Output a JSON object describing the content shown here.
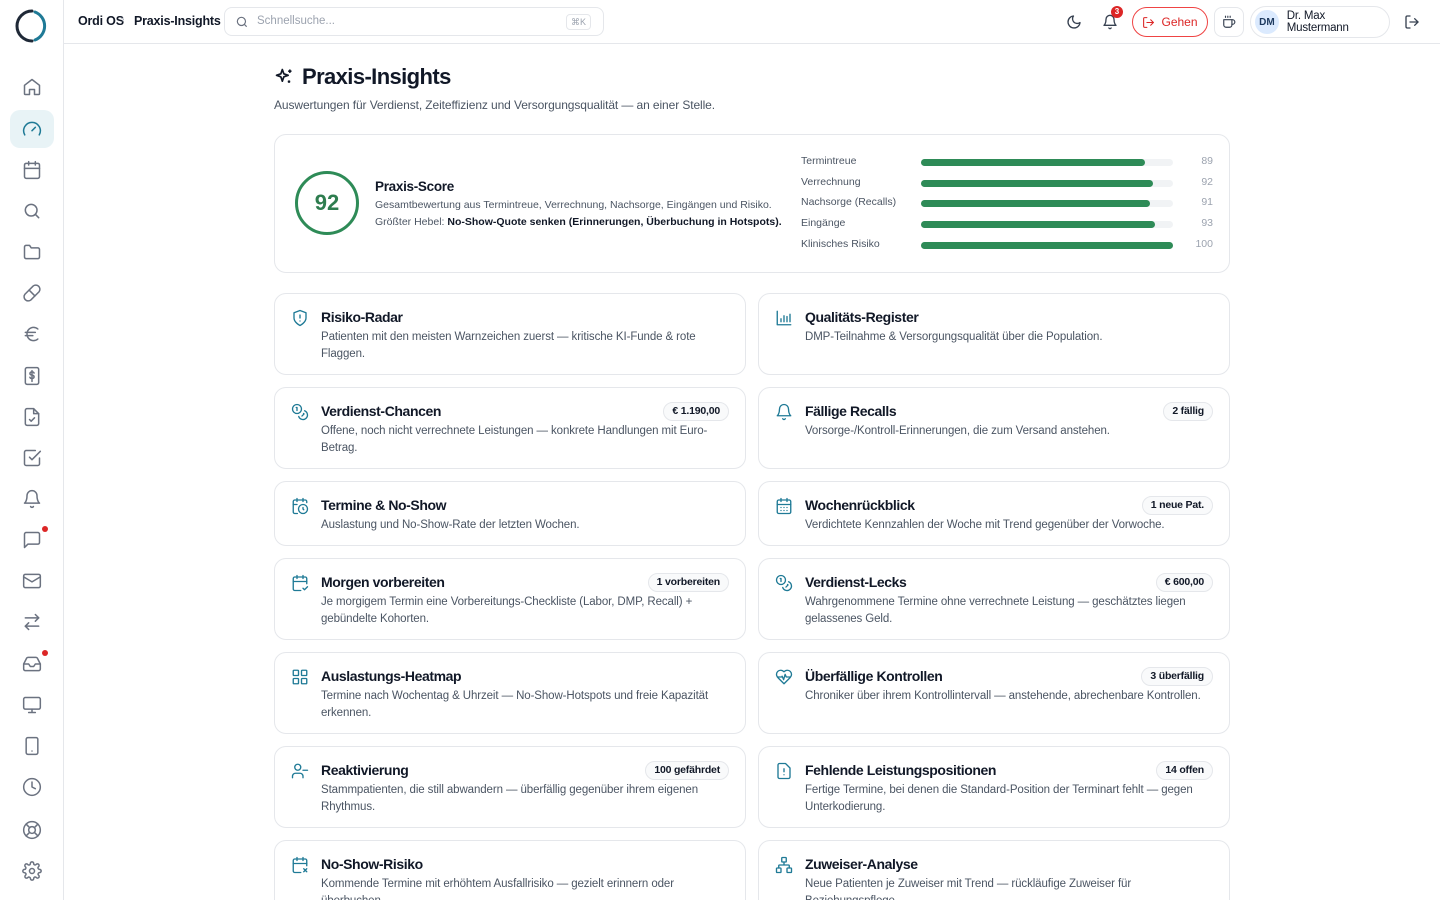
{
  "app": {
    "name": "Ordi OS",
    "page": "Praxis-Insights"
  },
  "search": {
    "placeholder": "Schnellsuche...",
    "shortcut": "⌘K"
  },
  "header": {
    "notification_count": "3",
    "go_label": "Gehen",
    "user_initials": "DM",
    "user_name": "Dr. Max Mustermann"
  },
  "page": {
    "title": "Praxis-Insights",
    "subtitle": "Auswertungen für Verdienst, Zeiteffizienz und Versorgungsqualität — an einer Stelle."
  },
  "score": {
    "value": "92",
    "title": "Praxis-Score",
    "description": "Gesamtbewertung aus Termintreue, Verrechnung, Nachsorge, Eingängen und Risiko.",
    "lever_label": "Größter Hebel:",
    "lever_text": "No-Show-Quote senken (Erinnerungen, Überbuchung in Hotspots).",
    "metrics": [
      {
        "label": "Termintreue",
        "value": 89
      },
      {
        "label": "Verrechnung",
        "value": 92
      },
      {
        "label": "Nachsorge (Recalls)",
        "value": 91
      },
      {
        "label": "Eingänge",
        "value": 93
      },
      {
        "label": "Klinisches Risiko",
        "value": 100
      }
    ]
  },
  "cards": [
    {
      "title": "Risiko-Radar",
      "description": "Patienten mit den meisten Warnzeichen zuerst — kritische KI-Funde & rote Flaggen.",
      "badge": "",
      "icon": "shield-alert-icon"
    },
    {
      "title": "Qualitäts-Register",
      "description": "DMP-Teilnahme & Versorgungsqualität über die Population.",
      "badge": "",
      "icon": "bar-chart-icon"
    },
    {
      "title": "Verdienst-Chancen",
      "description": "Offene, noch nicht verrechnete Leistungen — konkrete Handlungen mit Euro-Betrag.",
      "badge": "€ 1.190,00",
      "icon": "coins-icon"
    },
    {
      "title": "Fällige Recalls",
      "description": "Vorsorge-/Kontroll-Erinnerungen, die zum Versand anstehen.",
      "badge": "2 fällig",
      "icon": "bell-icon"
    },
    {
      "title": "Termine & No-Show",
      "description": "Auslastung und No-Show-Rate der letzten Wochen.",
      "badge": "",
      "icon": "calendar-clock-icon"
    },
    {
      "title": "Wochenrückblick",
      "description": "Verdichtete Kennzahlen der Woche mit Trend gegenüber der Vorwoche.",
      "badge": "1 neue Pat.",
      "icon": "calendar-days-icon"
    },
    {
      "title": "Morgen vorbereiten",
      "description": "Je morgigem Termin eine Vorbereitungs-Checkliste (Labor, DMP, Recall) + gebündelte Kohorten.",
      "badge": "1 vorbereiten",
      "icon": "calendar-check-icon"
    },
    {
      "title": "Verdienst-Lecks",
      "description": "Wahrgenommene Termine ohne verrechnete Leistung — geschätztes liegen gelassenes Geld.",
      "badge": "€ 600,00",
      "icon": "coins-icon"
    },
    {
      "title": "Auslastungs-Heatmap",
      "description": "Termine nach Wochentag & Uhrzeit — No-Show-Hotspots und freie Kapazität erkennen.",
      "badge": "",
      "icon": "grid-icon"
    },
    {
      "title": "Überfällige Kontrollen",
      "description": "Chroniker über ihrem Kontrollintervall — anstehende, abrechenbare Kontrollen.",
      "badge": "3 überfällig",
      "icon": "heart-pulse-icon"
    },
    {
      "title": "Reaktivierung",
      "description": "Stammpatienten, die still abwandern — überfällig gegenüber ihrem eigenen Rhythmus.",
      "badge": "100 gefährdet",
      "icon": "user-minus-icon"
    },
    {
      "title": "Fehlende Leistungspositionen",
      "description": "Fertige Termine, bei denen die Standard-Position der Terminart fehlt — gegen Unterkodierung.",
      "badge": "14 offen",
      "icon": "file-alert-icon"
    },
    {
      "title": "No-Show-Risiko",
      "description": "Kommende Termine mit erhöhtem Ausfallrisiko — gezielt erinnern oder überbuchen.",
      "badge": "",
      "icon": "calendar-x-icon"
    },
    {
      "title": "Zuweiser-Analyse",
      "description": "Neue Patienten je Zuweiser mit Trend — rückläufige Zuweiser für Beziehungspflege.",
      "badge": "",
      "icon": "network-icon"
    }
  ],
  "sidebar": {
    "items": [
      {
        "icon": "home-icon"
      },
      {
        "icon": "gauge-icon",
        "active": true
      },
      {
        "icon": "calendar-icon"
      },
      {
        "icon": "search-icon"
      },
      {
        "icon": "folder-icon"
      },
      {
        "icon": "pill-icon"
      },
      {
        "icon": "euro-icon"
      },
      {
        "icon": "dollar-receipt-icon"
      },
      {
        "icon": "file-check-icon"
      },
      {
        "icon": "checkbox-icon"
      },
      {
        "icon": "bell-icon"
      },
      {
        "icon": "message-icon",
        "dot": true
      },
      {
        "icon": "mail-icon"
      },
      {
        "icon": "transfer-icon"
      },
      {
        "icon": "inbox-icon",
        "dot": true
      },
      {
        "icon": "monitor-icon"
      },
      {
        "icon": "tablet-icon"
      },
      {
        "icon": "clock-icon"
      },
      {
        "icon": "lifebuoy-icon"
      },
      {
        "icon": "settings-icon"
      }
    ]
  },
  "colors": {
    "accent": "#1f7a96",
    "score_green": "#2e8b57",
    "alert_red": "#dc2626"
  }
}
